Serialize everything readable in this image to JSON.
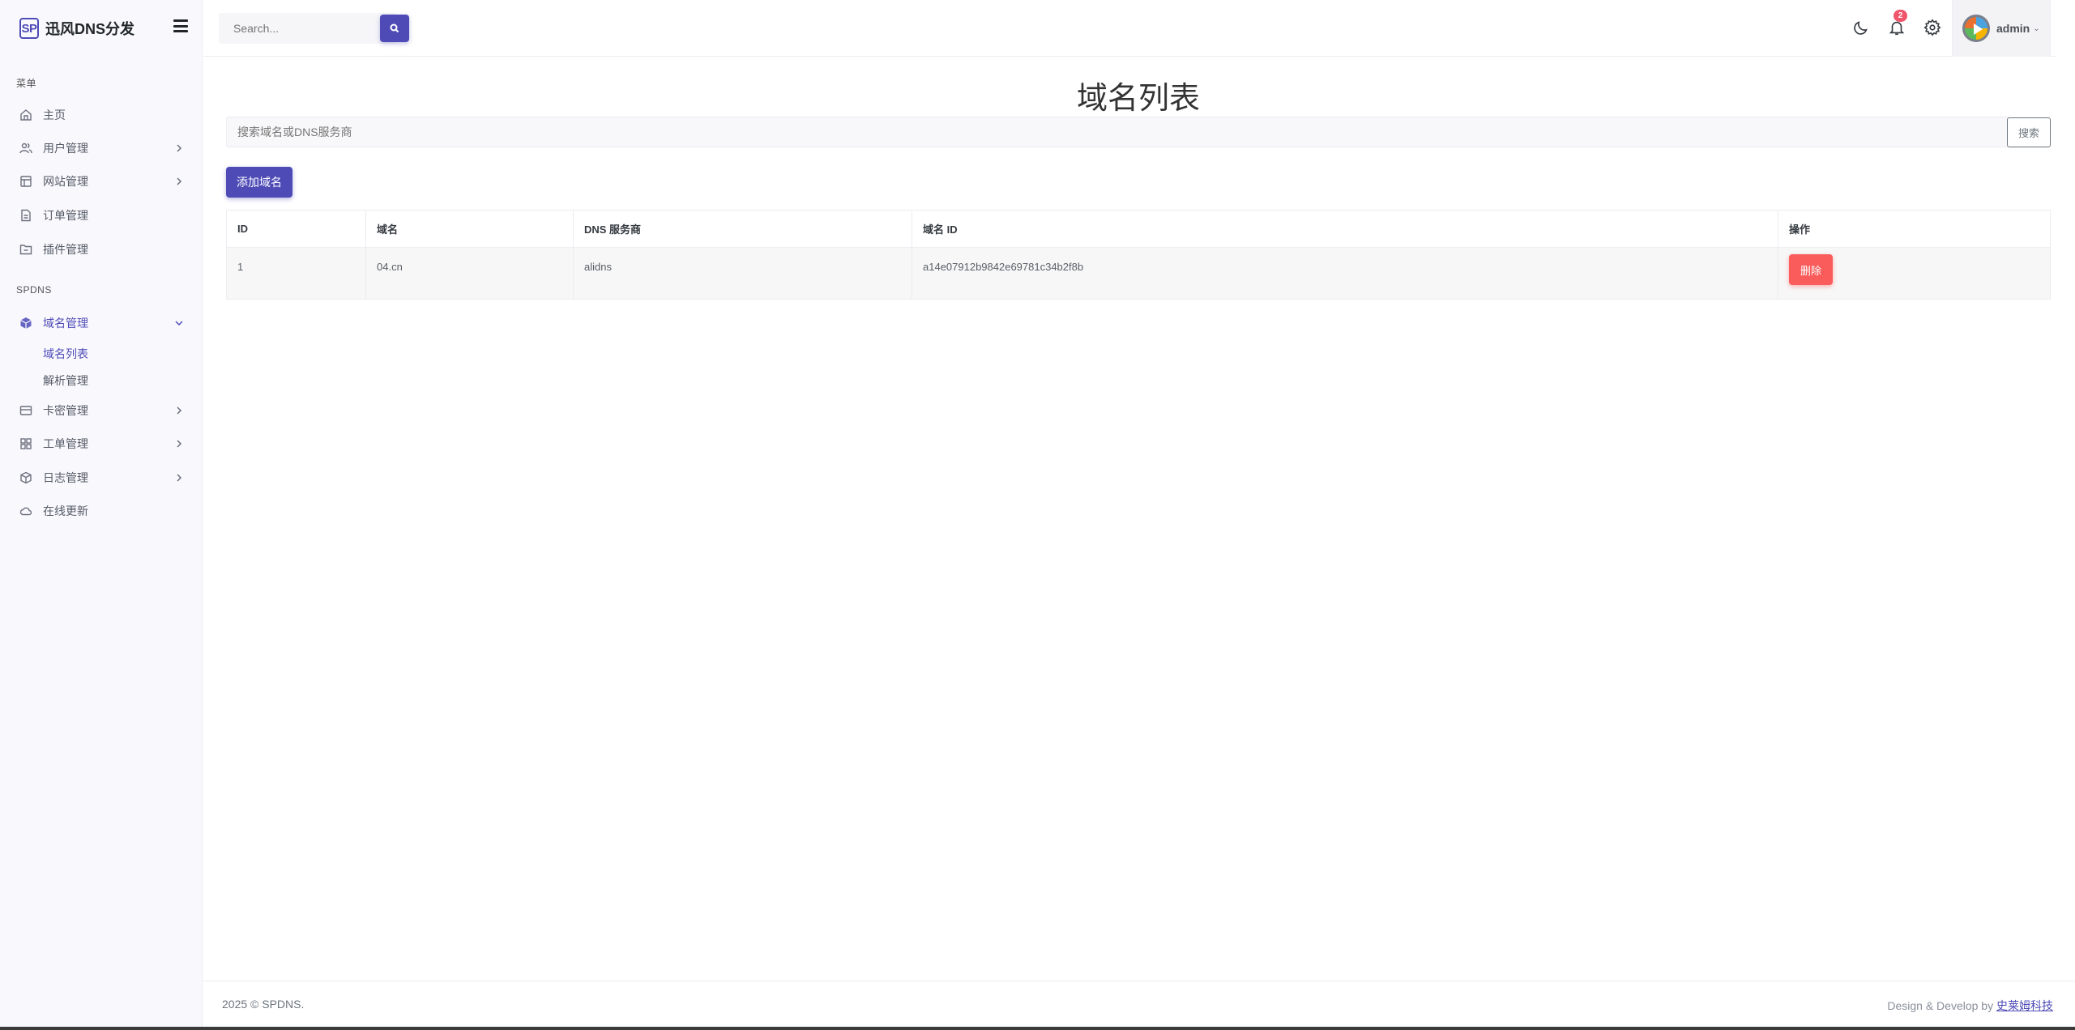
{
  "brand": {
    "logo_text": "SP",
    "name": "迅风DNS分发"
  },
  "topbar": {
    "search_placeholder": "Search...",
    "notification_count": "2",
    "user_name": "admin"
  },
  "sidebar": {
    "section_menu": "菜单",
    "section_spdns": "SPDNS",
    "items": [
      {
        "label": "主页",
        "icon": "home-icon"
      },
      {
        "label": "用户管理",
        "icon": "users-icon"
      },
      {
        "label": "网站管理",
        "icon": "layout-icon"
      },
      {
        "label": "订单管理",
        "icon": "file-icon"
      },
      {
        "label": "插件管理",
        "icon": "folder-icon"
      },
      {
        "label": "域名管理",
        "icon": "cube-icon"
      },
      {
        "label": "卡密管理",
        "icon": "credit-card-icon"
      },
      {
        "label": "工单管理",
        "icon": "grid-icon"
      },
      {
        "label": "日志管理",
        "icon": "box-icon"
      },
      {
        "label": "在线更新",
        "icon": "cloud-icon"
      }
    ],
    "sub_items": [
      {
        "label": "域名列表"
      },
      {
        "label": "解析管理"
      }
    ]
  },
  "main": {
    "title": "域名列表",
    "filter_placeholder": "搜索域名或DNS服务商",
    "filter_button": "搜索",
    "add_button": "添加域名",
    "table": {
      "headers": [
        "ID",
        "域名",
        "DNS 服务商",
        "域名 ID",
        "操作"
      ],
      "rows": [
        {
          "id": "1",
          "domain": "04.cn",
          "dns_provider": "alidns",
          "domain_id": "a14e07912b9842e69781c34b2f8b",
          "action": "删除"
        }
      ]
    }
  },
  "footer": {
    "copyright": "2025 © SPDNS.",
    "credit_prefix": "Design & Develop by ",
    "credit_link": "史莱姆科技"
  },
  "colors": {
    "primary": "#4e4bb7",
    "danger": "#fa5c5c",
    "badge": "#f1556c"
  }
}
